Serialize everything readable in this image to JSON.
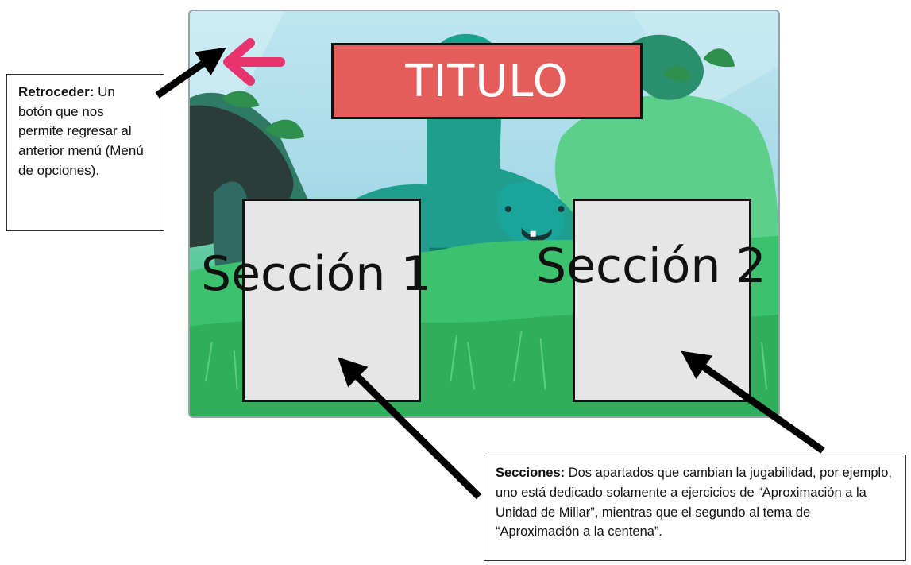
{
  "game": {
    "title": "TITULO",
    "back_button": {
      "icon": "arrow-left-icon",
      "color": "#e8336e"
    },
    "sections": [
      {
        "label": "Sección 1"
      },
      {
        "label": "Sección 2"
      }
    ],
    "colors": {
      "title_bg": "#e55d5b",
      "card_bg": "#e6e6e6",
      "dino": "#1f9e8e",
      "grass": "#39b86b"
    }
  },
  "annotations": {
    "back": {
      "term": "Retroceder:",
      "text": " Un botón que nos permite regresar al anterior menú (Menú de opciones)."
    },
    "sections": {
      "term": "Secciones:",
      "text": " Dos apartados que cambian la jugabilidad, por ejemplo, uno está dedicado solamente a ejercicios de “Aproximación a la Unidad de Millar”, mientras que el segundo al tema de “Aproximación a la centena”."
    }
  }
}
